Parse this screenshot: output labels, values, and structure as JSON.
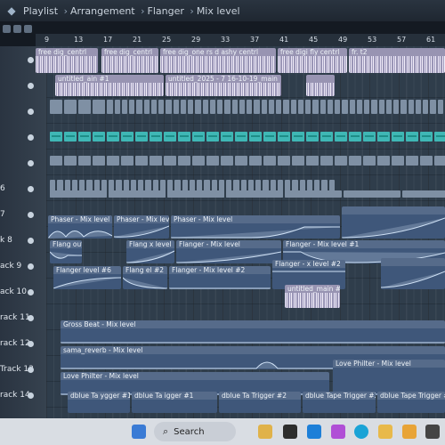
{
  "window": {
    "breadcrumb": [
      "Playlist",
      "Arrangement",
      "Flanger",
      "Mix level"
    ],
    "separator": "›"
  },
  "ruler": {
    "bars": [
      "9",
      "13",
      "17",
      "21",
      "25",
      "29",
      "33",
      "37",
      "41",
      "45",
      "49",
      "53",
      "57",
      "61"
    ]
  },
  "tracks": [
    {
      "label": "",
      "row": 0
    },
    {
      "label": "",
      "row": 1
    },
    {
      "label": "",
      "row": 2
    },
    {
      "label": "",
      "row": 3
    },
    {
      "label": "",
      "row": 4
    },
    {
      "label": "6",
      "row": 5
    },
    {
      "label": "7",
      "row": 6
    },
    {
      "label": "k 8",
      "row": 7
    },
    {
      "label": "ack 9",
      "row": 8
    },
    {
      "label": "ack 10",
      "row": 9
    },
    {
      "label": "rack 11",
      "row": 10
    },
    {
      "label": "rack 12",
      "row": 11
    },
    {
      "label": "Track 13",
      "row": 12
    },
    {
      "label": "rack 14",
      "row": 13
    }
  ],
  "clips": {
    "audio_1": "free dig_centrl",
    "audio_2": "free dig_centrl",
    "audio_3": "free dig_one rs d ashy centrl",
    "audio_4": "free digi fly centrl",
    "audio_5": "fr. t2",
    "untitled_1": "untitled_ain #1",
    "untitled_2": "untitled_2025 - 7 16-10-19_main",
    "phaser_1": "Phaser - Mix level",
    "phaser_2": "Phaser - Mix level",
    "phaser_3": "Phaser - Mix level",
    "flanger_1": "Flang out #8",
    "flanger_2": "Flang x level",
    "flanger_3": "Flanger - Mix level",
    "flanger_4": "Flanger - Mix level #1",
    "flanger_5": "Flanger level #6",
    "flanger_6": "Flang el #2",
    "flanger_7": "Flanger - Mix level #2",
    "flanger_8": "Flanger - x level #2",
    "untitled_main": "untitled_main #2",
    "gross_beat": "Gross Beat - Mix level",
    "reverb": "sama_reverb - Mix level",
    "love_1": "Love Philter - Mix level",
    "love_2": "Love Philter - Mix level",
    "dblue_1": "dblue Ta ygger #1",
    "dblue_2": "dblue Ta igger #1",
    "dblue_3": "dblue Ta Trigger #2",
    "dblue_4": "dblue Tape Trigger #2",
    "dblue_5": "dblue Tape Trigger #2"
  },
  "taskbar": {
    "search_label": "Search"
  }
}
